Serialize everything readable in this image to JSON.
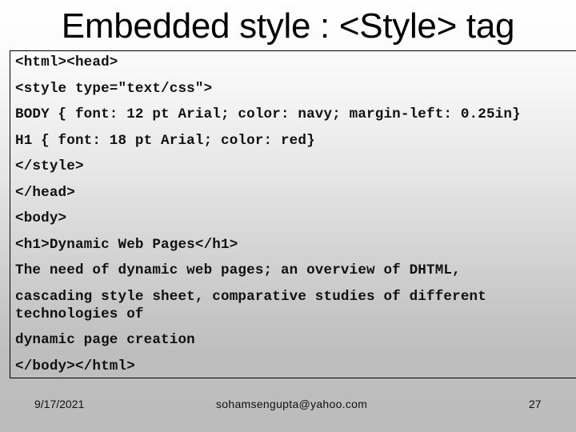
{
  "slide": {
    "title": "Embedded style : <Style> tag",
    "code_lines": [
      "<html><head>",
      "<style type=\"text/css\">",
      "BODY { font: 12 pt Arial; color: navy; margin-left: 0.25in}",
      "H1 { font: 18 pt Arial; color: red}",
      "</style>",
      "</head>",
      "<body>",
      "<h1>Dynamic Web Pages</h1>",
      "The need of dynamic web pages; an overview of DHTML,",
      "cascading style sheet, comparative studies of different technologies of",
      "dynamic page creation",
      "</body></html>"
    ]
  },
  "footer": {
    "date": "9/17/2021",
    "email": "sohamsengupta@yahoo.com",
    "page_number": "27"
  }
}
